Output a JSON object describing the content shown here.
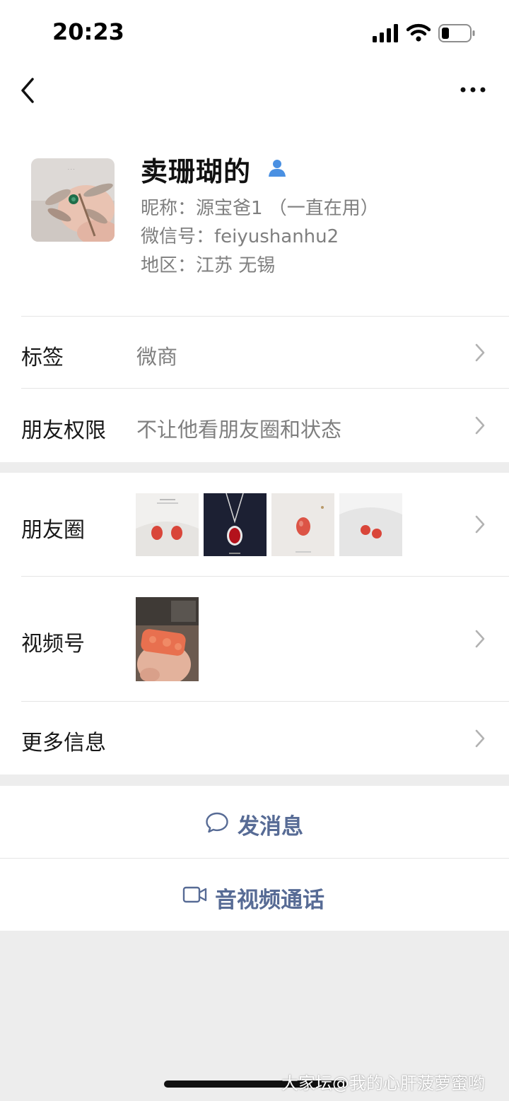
{
  "status_bar": {
    "time": "20:23"
  },
  "profile": {
    "name": "卖珊瑚的",
    "nickname": "昵称：源宝爸1 （一直在用）",
    "wechat_id": "微信号：feiyushanhu2",
    "region": "地区：江苏 无锡"
  },
  "rows": {
    "tags": {
      "label": "标签",
      "value": "微商"
    },
    "permissions": {
      "label": "朋友权限",
      "value": "不让他看朋友圈和状态"
    },
    "moments": {
      "label": "朋友圈"
    },
    "channels": {
      "label": "视频号"
    },
    "more_info": {
      "label": "更多信息"
    }
  },
  "actions": {
    "message": "发消息",
    "call": "音视频通话"
  },
  "watermark": "大家坛@我的心肝菠萝蜜哟",
  "colors": {
    "link": "#576b95",
    "verified": "#4a90e2",
    "coral": "#d9463a"
  }
}
